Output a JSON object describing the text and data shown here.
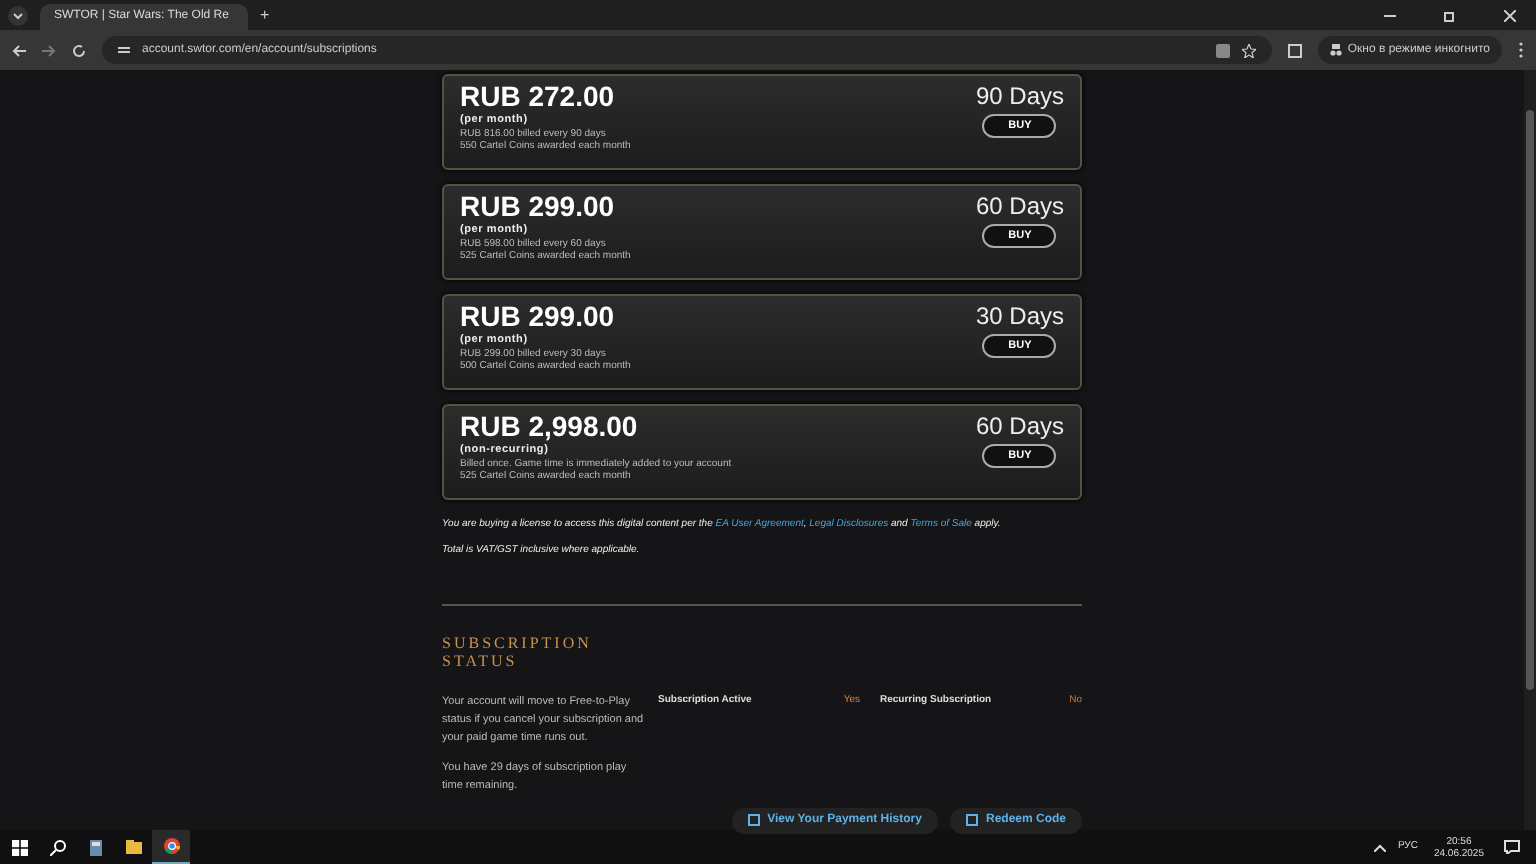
{
  "browser": {
    "tab_title": "SWTOR | Star Wars: The Old Re",
    "new_tab": "+",
    "address": "account.swtor.com/en/account/subscriptions",
    "incognito_label": "Окно в режиме инкогнито"
  },
  "plans": [
    {
      "price": "RUB 272.00",
      "term": "(per month)",
      "billing": "RUB 816.00 billed every 90 days",
      "coins": "550 Cartel Coins awarded each month",
      "duration": "90 Days",
      "button": "BUY"
    },
    {
      "price": "RUB 299.00",
      "term": "(per month)",
      "billing": "RUB 598.00 billed every 60 days",
      "coins": "525 Cartel Coins awarded each month",
      "duration": "60 Days",
      "button": "BUY"
    },
    {
      "price": "RUB 299.00",
      "term": "(per month)",
      "billing": "RUB 299.00 billed every 30 days",
      "coins": "500 Cartel Coins awarded each month",
      "duration": "30 Days",
      "button": "BUY"
    },
    {
      "price": "RUB 2,998.00",
      "term": "(non-recurring)",
      "billing": "Billed once. Game time is immediately added to your account",
      "coins": "525 Cartel Coins awarded each month",
      "duration": "60 Days",
      "button": "BUY"
    }
  ],
  "legal": {
    "before": "You are buying a license to access this digital content per the",
    "link_1": "EA User Agreement",
    "sep": ",",
    "link_2": "Legal Disclosures",
    "and": "and",
    "link_3": "Terms of Sale",
    "after": "apply."
  },
  "vat_note": "Total is VAT/GST inclusive where applicable.",
  "status": {
    "heading": "SUBSCRIPTION STATUS",
    "note_1": "Your account will move to Free-to-Play status if you cancel your subscription and your paid game time runs out.",
    "note_2": "You have 29 days of subscription play time remaining.",
    "fields": [
      {
        "label": "Subscription Active",
        "value": "Yes"
      },
      {
        "label": "Recurring Subscription",
        "value": "No"
      }
    ],
    "buttons": [
      "View Your Payment History",
      "Redeem Code"
    ]
  },
  "taskbar": {
    "language": "РУС",
    "time": "20:56",
    "date": "24.06.2025"
  }
}
